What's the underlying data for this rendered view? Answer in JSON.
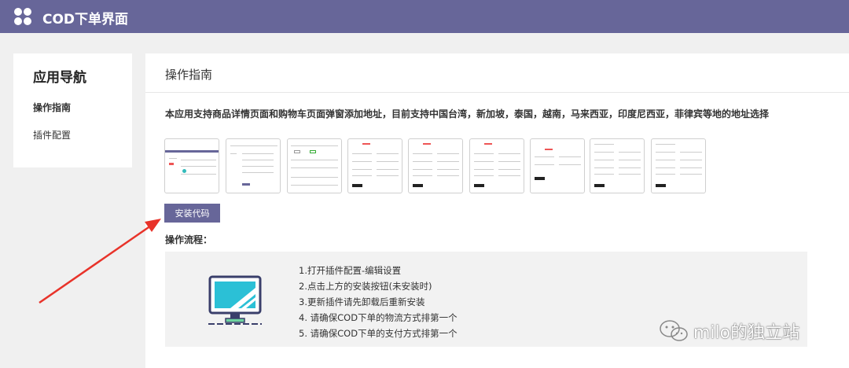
{
  "header": {
    "title": "COD下单界面",
    "bg_color": "#676699"
  },
  "sidebar": {
    "title": "应用导航",
    "items": [
      {
        "label": "操作指南",
        "active": true
      },
      {
        "label": "插件配置",
        "active": false
      }
    ]
  },
  "main": {
    "title": "操作指南",
    "description": "本应用支持商品详情页面和购物车页面弹窗添加地址，目前支持中国台湾，新加坡，泰国，越南，马来西亚，印度尼西亚，菲律宾等地的地址选择",
    "install_button": "安装代码",
    "flow_label": "操作流程：",
    "steps": [
      "1.打开插件配置-编辑设置",
      "2.点击上方的安装按钮(未安装时)",
      "3.更新插件请先卸载后重新安装",
      "4. 请确保COD下单的物流方式排第一个",
      "5. 请确保COD下单的支付方式排第一个"
    ]
  },
  "watermark": {
    "text": "milo的独立站",
    "icon": "wechat-icon"
  }
}
